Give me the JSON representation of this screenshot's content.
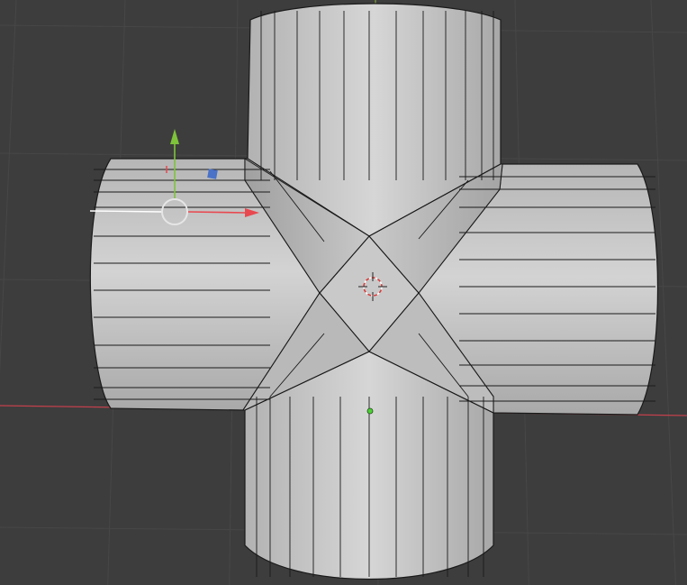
{
  "viewport": {
    "background": "#3d3d3d",
    "grid_color": "#474747",
    "x_axis_color": "#c2404c",
    "y_axis_color": "#7fa33a"
  },
  "mesh": {
    "name": "pipe-cross-junction",
    "surface_color": "#c4c4c4",
    "edge_color": "#1a1a1a"
  },
  "gizmo": {
    "x_arrow_color": "#e8484f",
    "y_arrow_color": "#7ec33a",
    "z_handle_color": "#4a72c7",
    "pivot_ring_color": "#e6e6e6"
  },
  "cursor_3d": {
    "color": "#d63a3a"
  },
  "origin_point": {
    "color": "#4fcf38"
  }
}
